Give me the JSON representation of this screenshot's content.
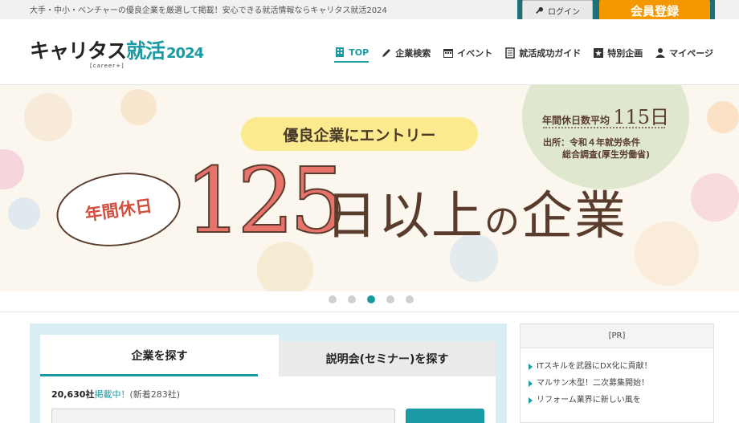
{
  "top": {
    "tagline": "大手・中小・ベンチャーの優良企業を厳選して掲載！安心できる就活情報ならキャリタス就活2024",
    "login_label": "ログイン",
    "register_label": "会員登録"
  },
  "logo": {
    "main": "キャリタス",
    "accent": "就活",
    "year": "2024",
    "sub": "[career+]"
  },
  "nav": {
    "items": [
      {
        "label": "TOP",
        "icon": "building-icon",
        "active": true
      },
      {
        "label": "企業検索",
        "icon": "pencil-icon"
      },
      {
        "label": "イベント",
        "icon": "calendar-icon"
      },
      {
        "label": "就活成功ガイド",
        "icon": "document-icon"
      },
      {
        "label": "特別企画",
        "icon": "bookmark-icon"
      },
      {
        "label": "マイページ",
        "icon": "person-icon"
      }
    ]
  },
  "banner": {
    "pill": "優良企業にエントリー",
    "bubble": "年間休日",
    "big_number": "125",
    "big_rest_1": "日以上",
    "big_rest_no": "の",
    "big_rest_2": "企業",
    "stat_label": "年間休日数平均",
    "stat_value": "115日",
    "source_line1": "出所：令和４年就労条件",
    "source_line2": "総合調査(厚生労働省)"
  },
  "carousel": {
    "count": 5,
    "active_index": 2
  },
  "search": {
    "tab_find": "企業を探す",
    "tab_seminar": "説明会(セミナー)を探す",
    "count_num": "20,630社",
    "count_listed": "掲載中！",
    "count_new": "(新着283社)"
  },
  "pr": {
    "heading": "[PR]",
    "items": [
      "ITスキルを武器にDX化に貢献！",
      "マルサン木型！二次募集開始！",
      "リフォーム業界に新しい風を"
    ]
  },
  "colors": {
    "accent": "#1a9aa3",
    "orange": "#f39800",
    "coral": "#e8736a",
    "brown": "#5a3c2c"
  }
}
